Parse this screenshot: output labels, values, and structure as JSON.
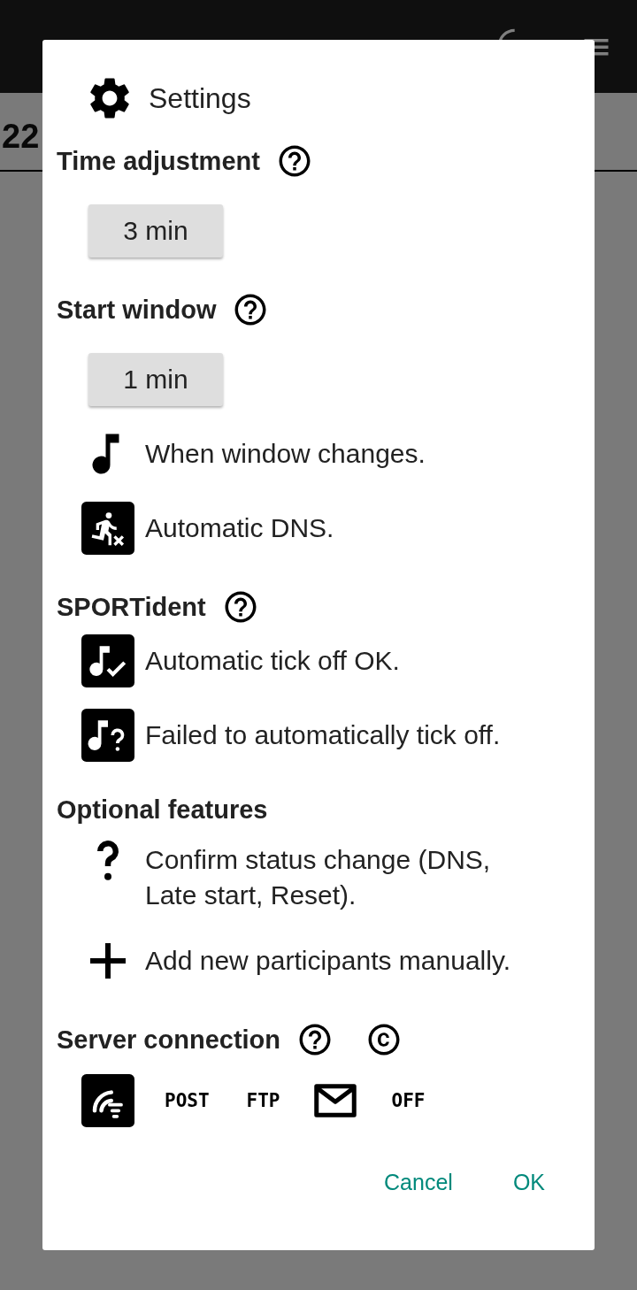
{
  "background": {
    "value": "22"
  },
  "dialog": {
    "title": "Settings",
    "sections": [
      {
        "heading": "Time adjustment",
        "icons": [
          {
            "kind": "help"
          }
        ],
        "items": [
          {
            "kind": "value_button",
            "label": "3 min"
          }
        ]
      },
      {
        "heading": "Start window",
        "icons": [
          {
            "kind": "help"
          }
        ],
        "items": [
          {
            "kind": "value_button",
            "label": "1 min"
          },
          {
            "kind": "note",
            "on": false,
            "text": "When window changes."
          },
          {
            "kind": "run",
            "on": true,
            "text": "Automatic DNS."
          }
        ]
      },
      {
        "heading": "SPORTident",
        "icons": [
          {
            "kind": "help"
          }
        ],
        "items": [
          {
            "kind": "note_check",
            "on": true,
            "text": "Automatic tick off OK."
          },
          {
            "kind": "note_question",
            "on": true,
            "text": "Failed to automatically tick off."
          }
        ]
      },
      {
        "heading": "Optional features",
        "items": [
          {
            "kind": "question",
            "on": false,
            "text": "Confirm status change (DNS, Late start, Reset)."
          },
          {
            "kind": "plus",
            "on": false,
            "text": "Add new participants manually."
          }
        ]
      },
      {
        "heading": "Server connection",
        "icons": [
          {
            "kind": "help"
          },
          {
            "kind": "copyright"
          }
        ],
        "items": [
          {
            "kind": "options",
            "options": [
              {
                "kind": "wifi",
                "selected": true
              },
              {
                "kind": "label",
                "label": "POST",
                "selected": false
              },
              {
                "kind": "label",
                "label": "FTP",
                "selected": false
              },
              {
                "kind": "mail",
                "selected": false
              },
              {
                "kind": "label",
                "label": "OFF",
                "selected": false
              }
            ]
          }
        ]
      }
    ],
    "buttons": [
      "Cancel",
      "OK"
    ]
  }
}
